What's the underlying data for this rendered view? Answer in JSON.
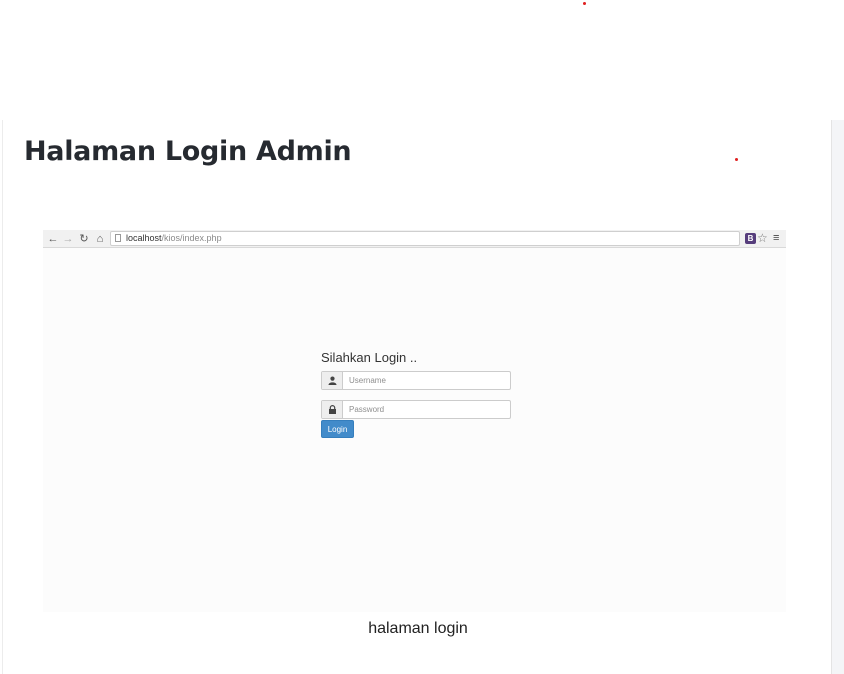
{
  "colors": {
    "title_text": "#262a30",
    "button_primary": "#428bca",
    "accent_dot": "#e02020",
    "bootstrap_badge": "#563d7c"
  },
  "article": {
    "title": "Halaman Login Admin",
    "caption": "halaman login"
  },
  "screenshot": {
    "browser": {
      "back_icon": "arrow-left-icon",
      "forward_icon": "arrow-right-icon",
      "reload_icon": "reload-icon",
      "home_icon": "home-icon",
      "url_host": "localhost",
      "url_path": "/kios/index.php",
      "extension_label": "B",
      "star_icon": "star-icon",
      "menu_icon": "hamburger-menu-icon"
    },
    "login_form": {
      "heading": "Silahkan Login ..",
      "username_placeholder": "Username",
      "password_placeholder": "Password",
      "username_icon": "user-icon",
      "password_icon": "lock-icon",
      "submit_label": "Login"
    }
  }
}
